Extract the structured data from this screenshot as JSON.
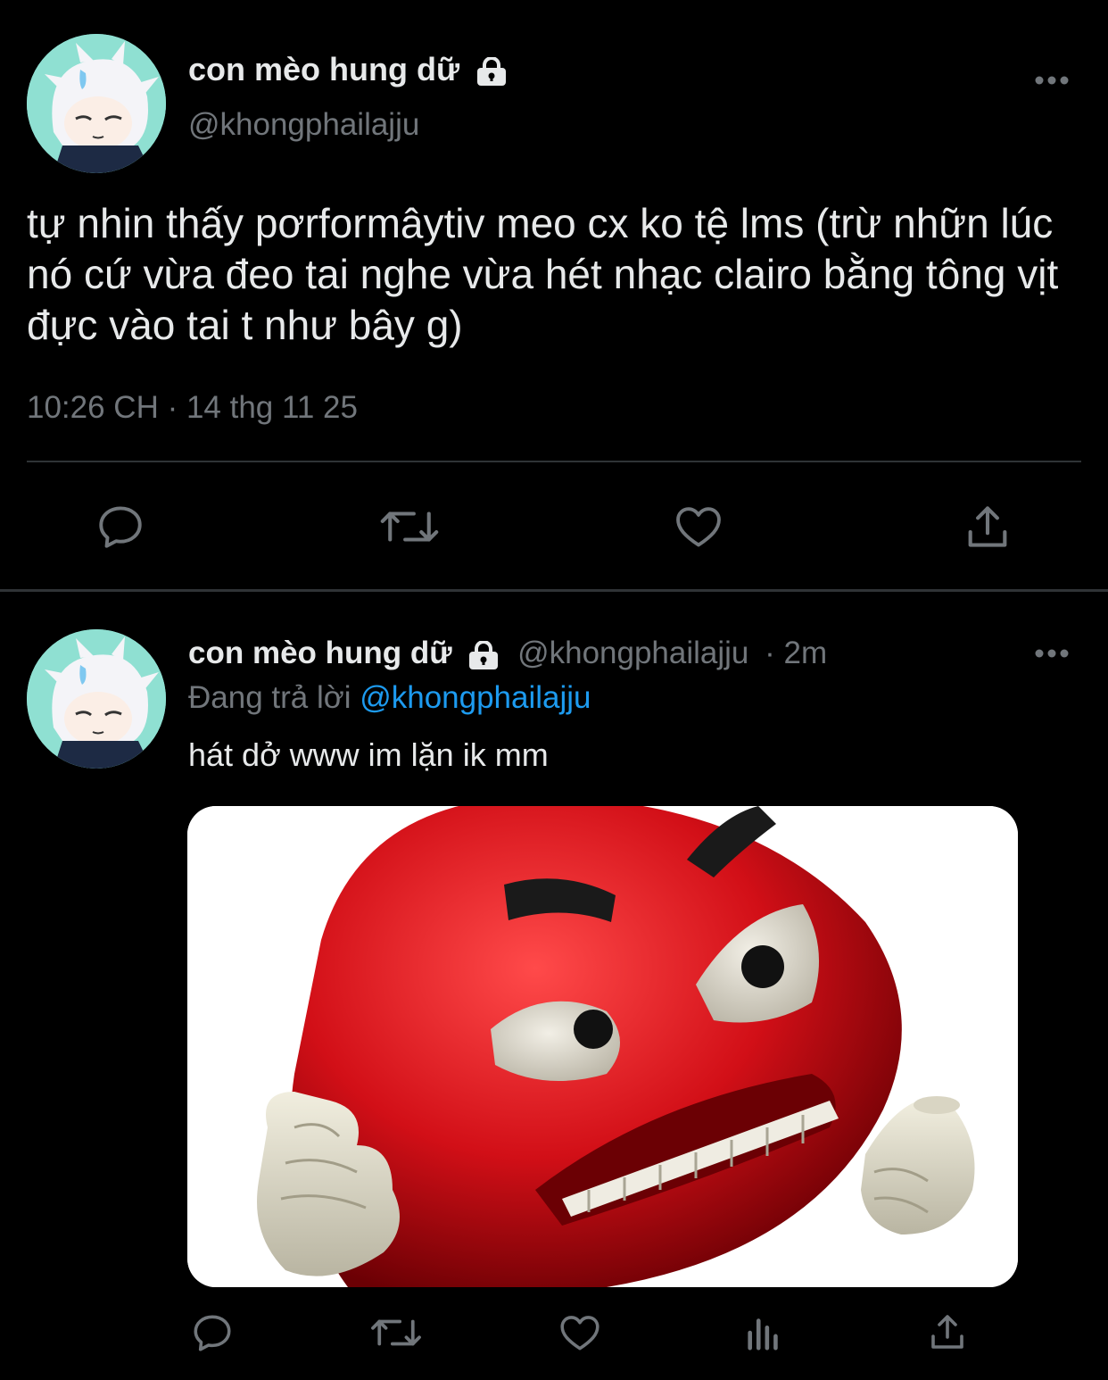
{
  "main_tweet": {
    "display_name": "con mèo hung dữ",
    "handle": "@khongphailajju",
    "text": "tự nhin thấy pơrformâytiv meo cx ko tệ lms (trừ nhữn lúc nó cứ vừa đeo tai nghe vừa hét nhạc clairo bằng tông vịt đực vào tai t như bây g)",
    "timestamp": "10:26 CH · 14 thg 11 25",
    "actions": [
      "reply-icon",
      "retweet-icon",
      "like-icon",
      "share-icon"
    ]
  },
  "reply_tweet": {
    "display_name": "con mèo hung dữ",
    "handle": "@khongphailajju",
    "time_ago": "· 2m",
    "replying_prefix": "Đang trả lời",
    "replying_to": "@khongphailajju",
    "text": "hát dở www im lặn ik mm",
    "media": {
      "type": "image",
      "description_icon": "angry-red-emoji-image"
    },
    "actions": [
      "reply-icon",
      "retweet-icon",
      "like-icon",
      "analytics-icon",
      "share-icon"
    ]
  },
  "colors": {
    "background": "#000000",
    "primary_text": "#e7e9ea",
    "secondary_text": "#71767b",
    "link": "#1d9bf0",
    "divider": "#2f3336"
  }
}
